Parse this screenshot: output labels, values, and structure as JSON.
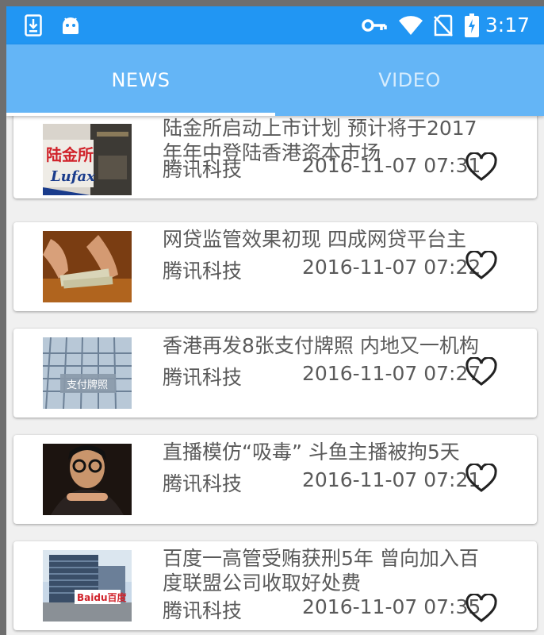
{
  "status_bar": {
    "time": "3:17",
    "icons": [
      "download-icon",
      "android-icon",
      "key-icon",
      "wifi-icon",
      "no-sim-icon",
      "battery-charging-icon"
    ]
  },
  "tabs": [
    {
      "label": "NEWS",
      "selected": true
    },
    {
      "label": "VIDEO",
      "selected": false
    }
  ],
  "colors": {
    "status_bar": "#2196f3",
    "tab_bar": "#64b5f6",
    "card_text": "#5a5a5a"
  },
  "news": [
    {
      "title": "陆金所启动上市计划 预计将于2017年年中登陆香港资本市场",
      "source": "腾讯科技",
      "time": "2016-11-07 07:31",
      "thumb_text": "陆金所 Lufax"
    },
    {
      "title": "网贷监管效果初现 四成网贷平台主",
      "source": "腾讯科技",
      "time": "2016-11-07 07:22",
      "thumb_text": ""
    },
    {
      "title": "香港再发8张支付牌照 内地又一机构",
      "source": "腾讯科技",
      "time": "2016-11-07 07:27",
      "thumb_text": "支付牌照"
    },
    {
      "title": "直播模仿“吸毒” 斗鱼主播被拘5天",
      "source": "腾讯科技",
      "time": "2016-11-07 07:21",
      "thumb_text": ""
    },
    {
      "title": "百度一高管受贿获刑5年 曾向加入百度联盟公司收取好处费",
      "source": "腾讯科技",
      "time": "2016-11-07 07:35",
      "thumb_text": "Baidu百度"
    }
  ]
}
